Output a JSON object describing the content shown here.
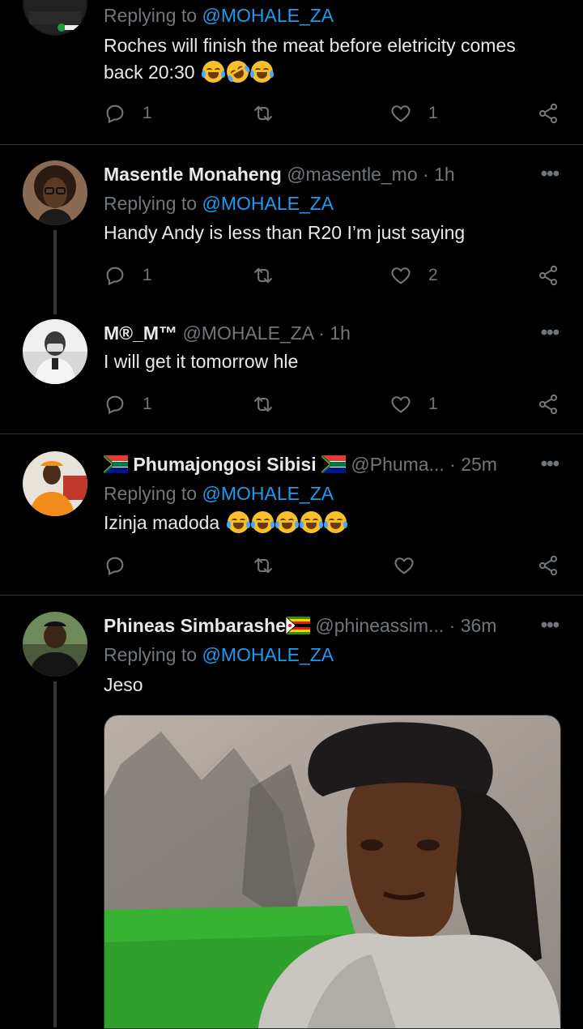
{
  "tweets": [
    {
      "reply_prefix": "Replying to",
      "reply_handle": "@MOHALE_ZA",
      "text": "Roches will finish the meat before eletricity comes back 20:30",
      "emojis": [
        "tears-of-joy-emoji",
        "rofl-emoji",
        "tears-of-joy-emoji"
      ],
      "reply_count": "1",
      "retweet_count": "",
      "like_count": "1"
    },
    {
      "name": "Masentle Monaheng",
      "handle": "@masentle_mo",
      "time": "· 1h",
      "reply_prefix": "Replying to",
      "reply_handle": "@MOHALE_ZA",
      "text": "Handy Andy is less than R20 I’m just saying",
      "reply_count": "1",
      "retweet_count": "",
      "like_count": "2"
    },
    {
      "name": "M®_M™",
      "handle": "@MOHALE_ZA",
      "time": "· 1h",
      "text": "I will get it tomorrow hle",
      "reply_count": "1",
      "retweet_count": "",
      "like_count": "1"
    },
    {
      "name": "Phumajongosi Sibisi",
      "name_flags": [
        "south-africa-flag",
        "south-africa-flag"
      ],
      "handle": "@Phuma...",
      "time": "· 25m",
      "reply_prefix": "Replying to",
      "reply_handle": "@MOHALE_ZA",
      "text": "Izinja madoda",
      "emojis": [
        "tears-of-joy-emoji",
        "tears-of-joy-emoji",
        "tears-of-joy-emoji",
        "tears-of-joy-emoji",
        "tears-of-joy-emoji"
      ],
      "reply_count": "",
      "retweet_count": "",
      "like_count": ""
    },
    {
      "name": "Phineas Simbarashe",
      "name_flags": [
        "zimbabwe-flag"
      ],
      "handle": "@phineassim...",
      "time": "· 36m",
      "reply_prefix": "Replying to",
      "reply_handle": "@MOHALE_ZA",
      "text": "Jeso",
      "media": "meme-photo"
    }
  ],
  "more_label": "•••",
  "colors": {
    "background": "#000000",
    "text": "#e7e9ea",
    "muted": "#71767b",
    "link": "#1d9bf0",
    "divider": "#2f3336"
  }
}
